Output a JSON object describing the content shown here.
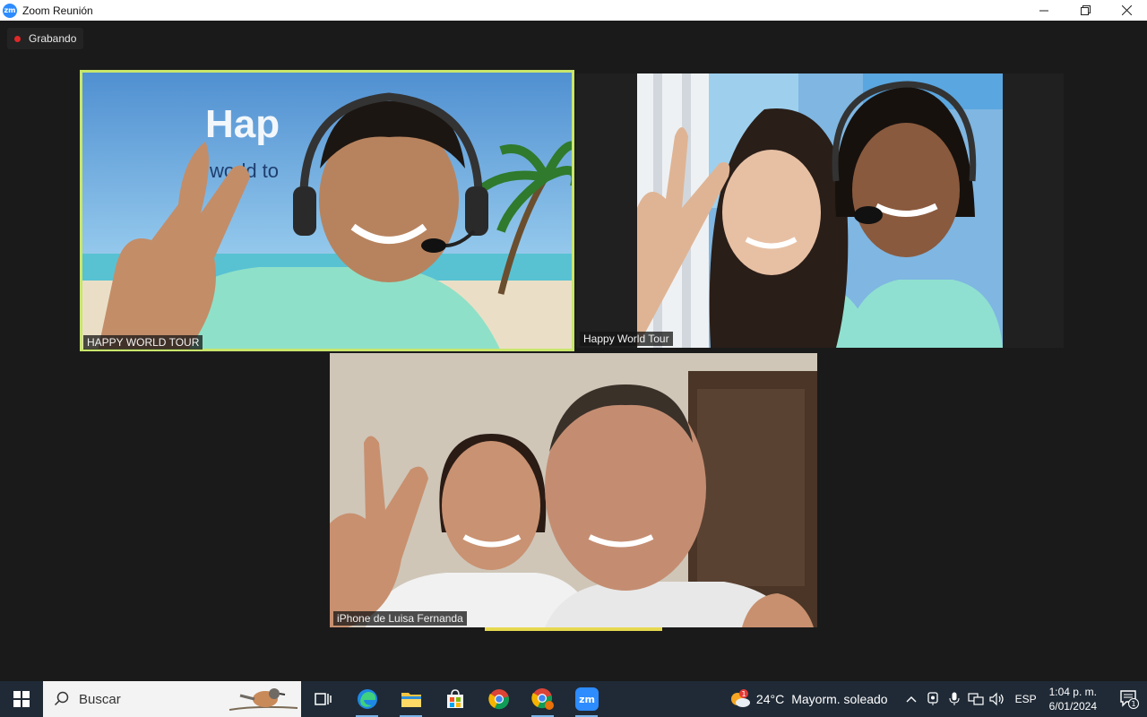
{
  "window": {
    "logo_text": "zm",
    "title": "Zoom Reunión",
    "controls": {
      "minimize": "—",
      "restore": "❐",
      "close": "✕"
    }
  },
  "meeting": {
    "recording_label": "Grabando",
    "participants": [
      {
        "name": "HAPPY WORLD TOUR",
        "active_speaker": true
      },
      {
        "name": "Happy World Tour",
        "active_speaker": false
      },
      {
        "name": "iPhone de Luisa Fernanda",
        "active_speaker": false
      }
    ],
    "backdrop_brand_text": "Hap",
    "backdrop_brand_sub": "world to"
  },
  "taskbar": {
    "search_placeholder": "Buscar",
    "apps": [
      {
        "name": "task-view",
        "icon": "task-view-icon"
      },
      {
        "name": "edge",
        "icon": "edge-icon"
      },
      {
        "name": "file-explorer",
        "icon": "folder-icon"
      },
      {
        "name": "store",
        "icon": "store-icon"
      },
      {
        "name": "chrome",
        "icon": "chrome-icon"
      },
      {
        "name": "chrome-profile",
        "icon": "chrome-profile-icon"
      },
      {
        "name": "zoom",
        "icon": "zoom-icon",
        "label": "zm"
      }
    ],
    "weather": {
      "temp": "24°C",
      "description": "Mayorm. soleado",
      "badge": "1"
    },
    "language": "ESP",
    "time": "1:04 p. m.",
    "date": "6/01/2024",
    "notification_count": "1"
  }
}
